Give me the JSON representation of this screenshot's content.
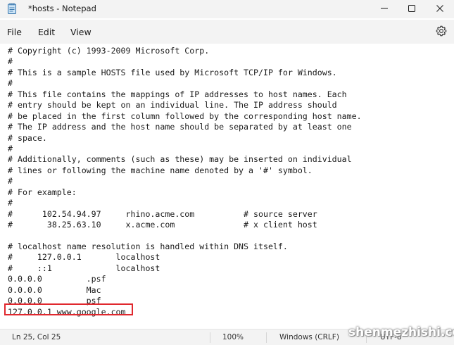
{
  "window": {
    "title": "*hosts - Notepad"
  },
  "menu": {
    "file": "File",
    "edit": "Edit",
    "view": "View"
  },
  "icons": {
    "app": "notepad-icon",
    "minimize": "minimize-icon",
    "maximize": "maximize-icon",
    "close": "close-icon",
    "settings": "gear-icon"
  },
  "editor": {
    "lines": [
      "# Copyright (c) 1993-2009 Microsoft Corp.",
      "#",
      "# This is a sample HOSTS file used by Microsoft TCP/IP for Windows.",
      "#",
      "# This file contains the mappings of IP addresses to host names. Each",
      "# entry should be kept on an individual line. The IP address should",
      "# be placed in the first column followed by the corresponding host name.",
      "# The IP address and the host name should be separated by at least one",
      "# space.",
      "#",
      "# Additionally, comments (such as these) may be inserted on individual",
      "# lines or following the machine name denoted by a '#' symbol.",
      "#",
      "# For example:",
      "#",
      "#      102.54.94.97     rhino.acme.com          # source server",
      "#       38.25.63.10     x.acme.com              # x client host",
      "",
      "# localhost name resolution is handled within DNS itself.",
      "#     127.0.0.1       localhost",
      "#     ::1             localhost",
      "0.0.0.0         .psf",
      "0.0.0.0         Mac",
      "0.0.0.0         psf",
      "127.0.0.1 www.google.com"
    ],
    "highlight_color": "#e0282e"
  },
  "status": {
    "position": "Ln 25, Col 25",
    "zoom": "100%",
    "line_ending": "Windows (CRLF)",
    "encoding": "UTF-8"
  },
  "watermark": "shenmezhishi.com"
}
